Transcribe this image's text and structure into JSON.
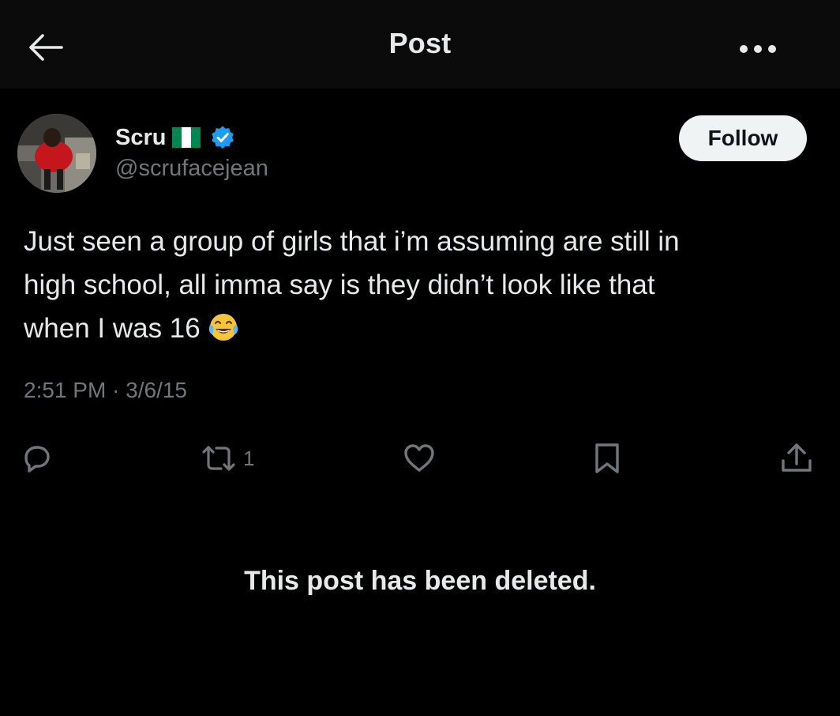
{
  "header": {
    "title": "Post",
    "back_icon": "arrow-left-icon",
    "more_icon": "more-horizontal-icon"
  },
  "author": {
    "display_name": "Scru",
    "flag_icon": "nigeria-flag-icon",
    "verified_icon": "verified-badge-icon",
    "handle": "@scrufacejean",
    "follow_label": "Follow"
  },
  "post": {
    "text": "Just seen a group of girls that i’m assuming are still in\nhigh school, all imma say is they didn’t look like that\nwhen I was 16",
    "emoji_icon": "face-with-tears-of-joy-icon",
    "timestamp": "2:51 PM · 3/6/15"
  },
  "actions": {
    "reply_icon": "reply-icon",
    "repost_icon": "repost-icon",
    "repost_count": "1",
    "like_icon": "heart-icon",
    "bookmark_icon": "bookmark-icon",
    "share_icon": "share-icon"
  },
  "notice": {
    "text": "This post has been deleted."
  },
  "colors": {
    "background": "#000000",
    "header_background": "#0b0b0b",
    "primary_text": "#e7e9ea",
    "secondary_text": "#71767b",
    "verified_blue": "#1d9bf0",
    "follow_button": "#eff3f4",
    "flag_green": "#008751"
  }
}
